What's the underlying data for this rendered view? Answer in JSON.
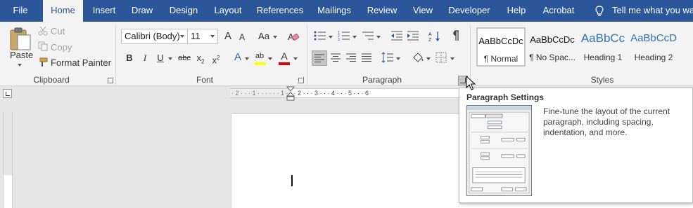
{
  "tabs": [
    {
      "label": "File",
      "active": false
    },
    {
      "label": "Home",
      "active": true
    },
    {
      "label": "Insert",
      "active": false
    },
    {
      "label": "Draw",
      "active": false
    },
    {
      "label": "Design",
      "active": false
    },
    {
      "label": "Layout",
      "active": false
    },
    {
      "label": "References",
      "active": false
    },
    {
      "label": "Mailings",
      "active": false
    },
    {
      "label": "Review",
      "active": false
    },
    {
      "label": "View",
      "active": false
    },
    {
      "label": "Developer",
      "active": false
    },
    {
      "label": "Help",
      "active": false
    },
    {
      "label": "Acrobat",
      "active": false
    }
  ],
  "tell_me": "Tell me what you want",
  "clipboard": {
    "label": "Clipboard",
    "paste": "Paste",
    "cut": "Cut",
    "copy": "Copy",
    "format_painter": "Format Painter"
  },
  "font": {
    "label": "Font",
    "font_name": "Calibri (Body)",
    "font_size": "11",
    "grow": "A",
    "shrink": "A",
    "change_case": "Aa",
    "bold": "B",
    "italic": "I",
    "underline": "U",
    "strikethrough": "abc",
    "subscript": "x",
    "superscript": "x",
    "text_effects": "A",
    "highlight": "ab",
    "font_color": "A",
    "highlight_color": "#ffff00",
    "font_color_value": "#e00000"
  },
  "paragraph": {
    "label": "Paragraph"
  },
  "styles": {
    "label": "Styles",
    "items": [
      {
        "sample": "AaBbCcDc",
        "name": "¶ Normal"
      },
      {
        "sample": "AaBbCcDc",
        "name": "¶ No Spac..."
      },
      {
        "sample": "AaBbCc",
        "name": "Heading 1"
      },
      {
        "sample": "AaBbCcD",
        "name": "Heading 2"
      }
    ]
  },
  "ruler": {
    "marks": "· 2 · · · 1 · · ·           · · · 1 · · · 2 · · · 3 · · · 4 · · · 5 · · · 6"
  },
  "tooltip": {
    "title": "Paragraph Settings",
    "description": "Fine-tune the layout of the current paragraph, including spacing, indentation, and more."
  },
  "colors": {
    "accent": "#2b579a",
    "ribbon_bg": "#f3f3f3",
    "workspace_bg": "#e6e6e6"
  }
}
